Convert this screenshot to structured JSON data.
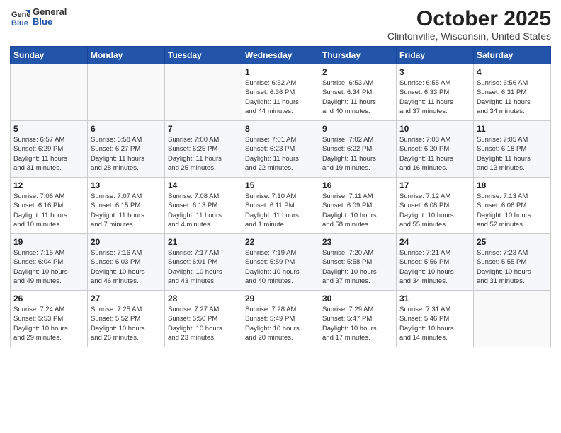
{
  "logo": {
    "general": "General",
    "blue": "Blue"
  },
  "header": {
    "month": "October 2025",
    "location": "Clintonville, Wisconsin, United States"
  },
  "weekdays": [
    "Sunday",
    "Monday",
    "Tuesday",
    "Wednesday",
    "Thursday",
    "Friday",
    "Saturday"
  ],
  "weeks": [
    [
      {
        "day": "",
        "detail": ""
      },
      {
        "day": "",
        "detail": ""
      },
      {
        "day": "",
        "detail": ""
      },
      {
        "day": "1",
        "detail": "Sunrise: 6:52 AM\nSunset: 6:36 PM\nDaylight: 11 hours\nand 44 minutes."
      },
      {
        "day": "2",
        "detail": "Sunrise: 6:53 AM\nSunset: 6:34 PM\nDaylight: 11 hours\nand 40 minutes."
      },
      {
        "day": "3",
        "detail": "Sunrise: 6:55 AM\nSunset: 6:33 PM\nDaylight: 11 hours\nand 37 minutes."
      },
      {
        "day": "4",
        "detail": "Sunrise: 6:56 AM\nSunset: 6:31 PM\nDaylight: 11 hours\nand 34 minutes."
      }
    ],
    [
      {
        "day": "5",
        "detail": "Sunrise: 6:57 AM\nSunset: 6:29 PM\nDaylight: 11 hours\nand 31 minutes."
      },
      {
        "day": "6",
        "detail": "Sunrise: 6:58 AM\nSunset: 6:27 PM\nDaylight: 11 hours\nand 28 minutes."
      },
      {
        "day": "7",
        "detail": "Sunrise: 7:00 AM\nSunset: 6:25 PM\nDaylight: 11 hours\nand 25 minutes."
      },
      {
        "day": "8",
        "detail": "Sunrise: 7:01 AM\nSunset: 6:23 PM\nDaylight: 11 hours\nand 22 minutes."
      },
      {
        "day": "9",
        "detail": "Sunrise: 7:02 AM\nSunset: 6:22 PM\nDaylight: 11 hours\nand 19 minutes."
      },
      {
        "day": "10",
        "detail": "Sunrise: 7:03 AM\nSunset: 6:20 PM\nDaylight: 11 hours\nand 16 minutes."
      },
      {
        "day": "11",
        "detail": "Sunrise: 7:05 AM\nSunset: 6:18 PM\nDaylight: 11 hours\nand 13 minutes."
      }
    ],
    [
      {
        "day": "12",
        "detail": "Sunrise: 7:06 AM\nSunset: 6:16 PM\nDaylight: 11 hours\nand 10 minutes."
      },
      {
        "day": "13",
        "detail": "Sunrise: 7:07 AM\nSunset: 6:15 PM\nDaylight: 11 hours\nand 7 minutes."
      },
      {
        "day": "14",
        "detail": "Sunrise: 7:08 AM\nSunset: 6:13 PM\nDaylight: 11 hours\nand 4 minutes."
      },
      {
        "day": "15",
        "detail": "Sunrise: 7:10 AM\nSunset: 6:11 PM\nDaylight: 11 hours\nand 1 minute."
      },
      {
        "day": "16",
        "detail": "Sunrise: 7:11 AM\nSunset: 6:09 PM\nDaylight: 10 hours\nand 58 minutes."
      },
      {
        "day": "17",
        "detail": "Sunrise: 7:12 AM\nSunset: 6:08 PM\nDaylight: 10 hours\nand 55 minutes."
      },
      {
        "day": "18",
        "detail": "Sunrise: 7:13 AM\nSunset: 6:06 PM\nDaylight: 10 hours\nand 52 minutes."
      }
    ],
    [
      {
        "day": "19",
        "detail": "Sunrise: 7:15 AM\nSunset: 6:04 PM\nDaylight: 10 hours\nand 49 minutes."
      },
      {
        "day": "20",
        "detail": "Sunrise: 7:16 AM\nSunset: 6:03 PM\nDaylight: 10 hours\nand 46 minutes."
      },
      {
        "day": "21",
        "detail": "Sunrise: 7:17 AM\nSunset: 6:01 PM\nDaylight: 10 hours\nand 43 minutes."
      },
      {
        "day": "22",
        "detail": "Sunrise: 7:19 AM\nSunset: 5:59 PM\nDaylight: 10 hours\nand 40 minutes."
      },
      {
        "day": "23",
        "detail": "Sunrise: 7:20 AM\nSunset: 5:58 PM\nDaylight: 10 hours\nand 37 minutes."
      },
      {
        "day": "24",
        "detail": "Sunrise: 7:21 AM\nSunset: 5:56 PM\nDaylight: 10 hours\nand 34 minutes."
      },
      {
        "day": "25",
        "detail": "Sunrise: 7:23 AM\nSunset: 5:55 PM\nDaylight: 10 hours\nand 31 minutes."
      }
    ],
    [
      {
        "day": "26",
        "detail": "Sunrise: 7:24 AM\nSunset: 5:53 PM\nDaylight: 10 hours\nand 29 minutes."
      },
      {
        "day": "27",
        "detail": "Sunrise: 7:25 AM\nSunset: 5:52 PM\nDaylight: 10 hours\nand 26 minutes."
      },
      {
        "day": "28",
        "detail": "Sunrise: 7:27 AM\nSunset: 5:50 PM\nDaylight: 10 hours\nand 23 minutes."
      },
      {
        "day": "29",
        "detail": "Sunrise: 7:28 AM\nSunset: 5:49 PM\nDaylight: 10 hours\nand 20 minutes."
      },
      {
        "day": "30",
        "detail": "Sunrise: 7:29 AM\nSunset: 5:47 PM\nDaylight: 10 hours\nand 17 minutes."
      },
      {
        "day": "31",
        "detail": "Sunrise: 7:31 AM\nSunset: 5:46 PM\nDaylight: 10 hours\nand 14 minutes."
      },
      {
        "day": "",
        "detail": ""
      }
    ]
  ]
}
